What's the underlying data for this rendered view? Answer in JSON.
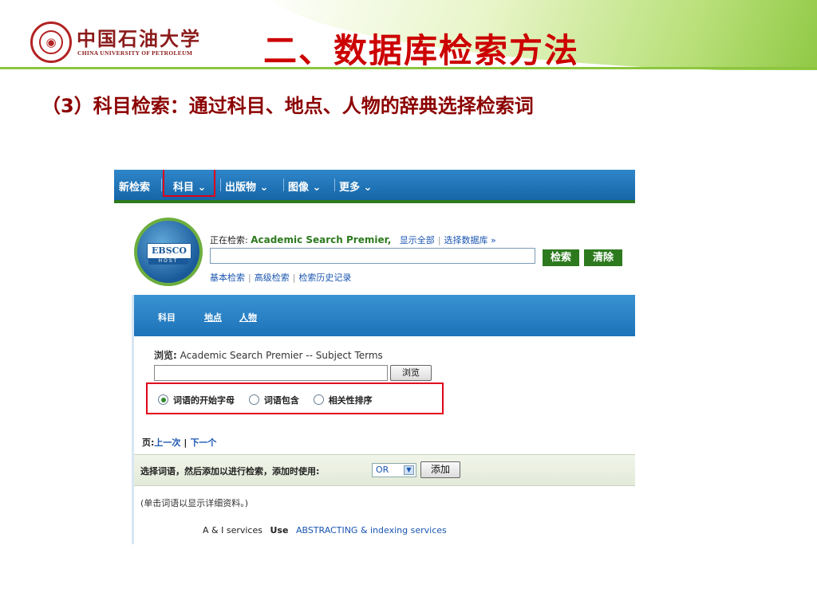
{
  "slide": {
    "university_cn": "中国石油大学",
    "university_en": "CHINA UNIVERSITY OF PETROLEUM",
    "title": "二、数据库检索方法",
    "subtitle": "（3）科目检索：通过科目、地点、人物的辞典选择检索词",
    "colors": {
      "title": "#cc0000",
      "subtitle": "#8b0000",
      "accent_green": "#8cc63f",
      "highlight_box": "#e0001a"
    }
  },
  "ebsco": {
    "topnav": [
      "新检索",
      "科目",
      "出版物",
      "图像",
      "更多"
    ],
    "logo_text": "EBSCO",
    "logo_subtext": "HOST",
    "searching_label": "正在检索:",
    "database": "Academic Search Premier,",
    "show_all": "显示全部",
    "choose_db": "选择数据库 »",
    "search_button": "检索",
    "clear_button": "清除",
    "search_links": [
      "基本检索",
      "高级检索",
      "检索历史记录"
    ],
    "tabs": [
      "科目",
      "地点",
      "人物"
    ],
    "browse_label": "浏览:",
    "browse_source": "Academic Search Premier -- Subject Terms",
    "browse_button": "浏览",
    "radio_options": [
      "词语的开始字母",
      "词语包含",
      "相关性排序"
    ],
    "pager_label": "页:",
    "pager_prev": "上一次",
    "pager_next": "下一个",
    "select_instruction": "选择词语，然后添加以进行检索，添加时使用:",
    "operator": "OR",
    "add_button": "添加",
    "hint": "(单击词语以显示详细资料。)",
    "term": "A & I services",
    "use_label": "Use",
    "term_target": "ABSTRACTING & indexing services",
    "colors": {
      "topbar": "#1f76bb",
      "green_button": "#2d7a1e",
      "link": "#1a55b0"
    }
  }
}
